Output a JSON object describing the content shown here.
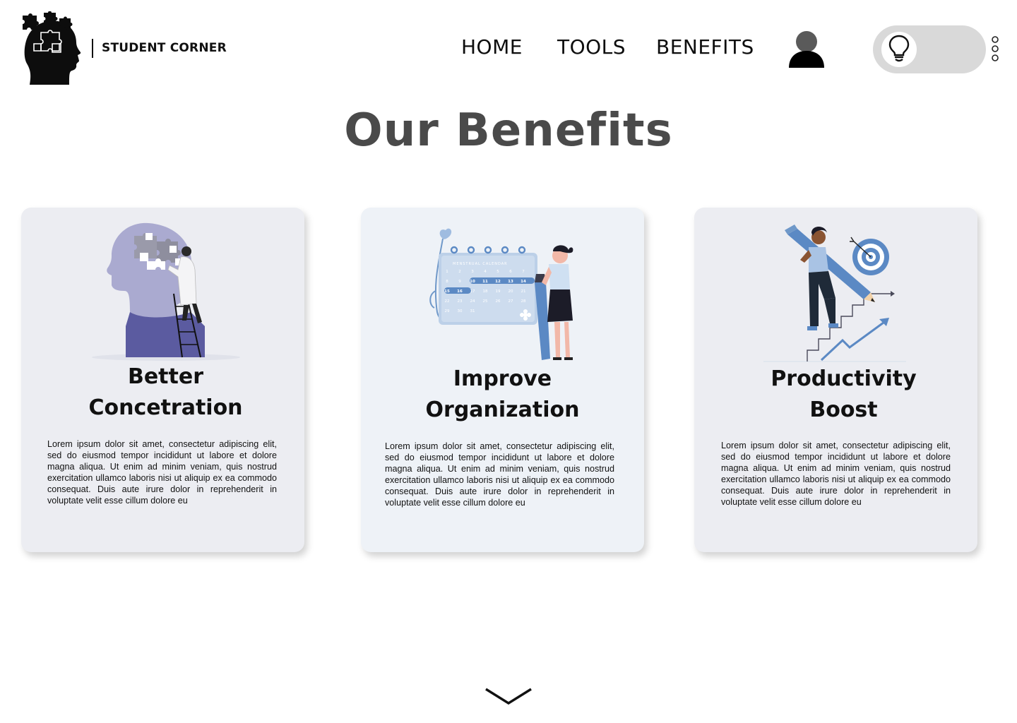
{
  "brand": {
    "name": "STUDENT CORNER",
    "logo_icon": "puzzle-head-icon"
  },
  "nav": {
    "items": [
      {
        "label": "HOME"
      },
      {
        "label": "TOOLS"
      },
      {
        "label": "BENEFITS"
      }
    ],
    "profile_icon": "user-icon",
    "theme_toggle_icon": "lightbulb-icon",
    "more_icon": "vertical-dots-icon"
  },
  "page": {
    "title": "Our Benefits"
  },
  "cards": [
    {
      "title_line1": "Better",
      "title_line2": "Concetration",
      "illustration": "puzzle-head-illustration",
      "text": "Lorem ipsum dolor sit amet, consectetur adipiscing elit, sed do eiusmod tempor incididunt ut labore et dolore magna aliqua. Ut enim ad minim veniam, quis nostrud exercitation ullamco laboris nisi ut aliquip ex ea commodo consequat. Duis aute irure dolor in reprehenderit in voluptate velit esse cillum dolore eu"
    },
    {
      "title_line1": "Improve",
      "title_line2": "Organization",
      "illustration": "calendar-illustration",
      "calendar_header": "MENSTRUAL CALENDAR",
      "calendar_days": [
        "1",
        "2",
        "3",
        "4",
        "5",
        "6",
        "7",
        "8",
        "9",
        "10",
        "11",
        "12",
        "13",
        "14",
        "15",
        "16",
        "17",
        "18",
        "19",
        "20",
        "21",
        "22",
        "23",
        "24",
        "25",
        "26",
        "27",
        "28",
        "29",
        "30",
        "31"
      ],
      "text": "Lorem ipsum dolor sit amet, consectetur adipiscing elit, sed do eiusmod tempor incididunt ut labore et dolore magna aliqua. Ut enim ad minim veniam, quis nostrud exercitation ullamco laboris nisi ut aliquip ex ea commodo consequat. Duis aute irure dolor in reprehenderit in voluptate velit esse cillum dolore eu"
    },
    {
      "title_line1": "Productivity",
      "title_line2": "Boost",
      "illustration": "target-stairs-illustration",
      "text": "Lorem ipsum dolor sit amet, consectetur adipiscing elit, sed do eiusmod tempor incididunt ut labore et dolore magna aliqua. Ut enim ad minim veniam, quis nostrud exercitation ullamco laboris nisi ut aliquip ex ea commodo consequat. Duis aute irure dolor in reprehenderit in voluptate velit esse cillum dolore eu"
    }
  ],
  "scroll": {
    "icon": "chevron-down-icon"
  },
  "colors": {
    "title": "#4a4a4a",
    "card_bg": "#ecedf2",
    "card2_bg": "#eef2f7",
    "toggle_bg": "#d9d9d9",
    "accent_purple": "#5a5a9e",
    "accent_blue": "#5b89c4"
  }
}
